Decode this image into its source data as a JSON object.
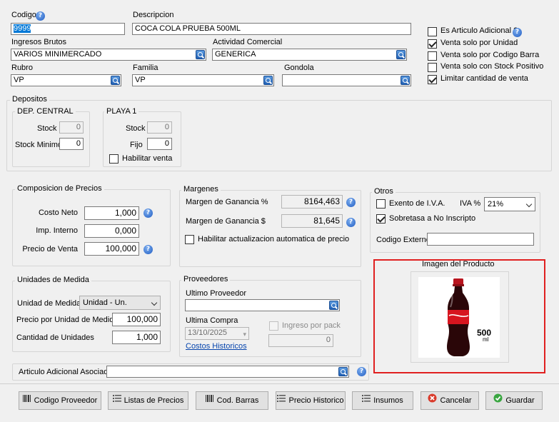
{
  "codigo": {
    "label": "Codigo",
    "value": "9999"
  },
  "descripcion": {
    "label": "Descripcion",
    "value": "COCA COLA PRUEBA 500ML"
  },
  "ingresos_brutos": {
    "label": "Ingresos Brutos",
    "value": "VARIOS MINIMERCADO"
  },
  "actividad_comercial": {
    "label": "Actividad Comercial",
    "value": "GENERICA"
  },
  "rubro": {
    "label": "Rubro",
    "value": "VP"
  },
  "familia": {
    "label": "Familia",
    "value": "VP"
  },
  "gondola": {
    "label": "Gondola",
    "value": ""
  },
  "flags": {
    "es_articulo_adicional": "Es Articulo Adicional ?",
    "venta_solo_por_unidad": "Venta solo por Unidad",
    "venta_solo_por_codigo_barra": "Venta solo por Codigo Barra",
    "venta_solo_con_stock_positivo": "Venta solo con Stock Positivo",
    "limitar_cantidad_de_venta": "Limitar cantidad de venta"
  },
  "depositos": {
    "title": "Depositos",
    "central": {
      "title": "DEP. CENTRAL",
      "stock_label": "Stock",
      "stock": "0",
      "stock_min_label": "Stock Minimo",
      "stock_min": "0"
    },
    "playa": {
      "title": "PLAYA 1",
      "stock_label": "Stock",
      "stock": "0",
      "fijo_label": "Fijo",
      "fijo": "0",
      "habilitar": "Habilitar venta"
    }
  },
  "precios": {
    "title": "Composicion de Precios",
    "costo_neto_label": "Costo Neto",
    "costo_neto": "1,000",
    "imp_interno_label": "Imp. Interno",
    "imp_interno": "0,000",
    "precio_venta_label": "Precio de Venta",
    "precio_venta": "100,000"
  },
  "margenes": {
    "title": "Margenes",
    "ganancia_pct_label": "Margen de Ganancia %",
    "ganancia_pct": "8164,463",
    "ganancia_pesos_label": "Margen de Ganancia $",
    "ganancia_pesos": "81,645",
    "auto_label": "Habilitar actualizacion automatica de precio"
  },
  "otros": {
    "title": "Otros",
    "exento_label": "Exento de I.V.A.",
    "iva_label": "IVA %",
    "iva_value": "21%",
    "sobretasa_label": "Sobretasa a No Inscripto",
    "codigo_externo_label": "Codigo Externo",
    "codigo_externo": ""
  },
  "unidades": {
    "title": "Unidades de Medida",
    "unidad_label": "Unidad de Medida",
    "unidad_value": "Unidad - Un.",
    "precio_unidad_label": "Precio por Unidad de Medida",
    "precio_unidad": "100,000",
    "cantidad_label": "Cantidad de Unidades",
    "cantidad": "1,000"
  },
  "proveedores": {
    "title": "Proveedores",
    "ultimo_label": "Ultimo Proveedor",
    "ultimo": "",
    "ultima_compra_label": "Ultima Compra",
    "ultima_compra": "13/10/2025",
    "ingreso_pack_label": "Ingreso por pack",
    "ingreso_pack": "0",
    "costos_link": "Costos Historicos"
  },
  "imagen": {
    "title": "Imagen del Producto",
    "volume": "500",
    "unit": "ml"
  },
  "articulo_adicional": {
    "label": "Articulo Adicional Asociado",
    "value": ""
  },
  "buttons": {
    "codigo_proveedor": "Codigo Proveedor",
    "listas_precios": "Listas de Precios",
    "cod_barras": "Cod. Barras",
    "precio_historico": "Precio Historico",
    "insumos": "Insumos",
    "cancelar": "Cancelar",
    "guardar": "Guardar"
  },
  "colors": {
    "highlight": "#e02020",
    "selection": "#0078d7",
    "link": "#0645ad"
  }
}
